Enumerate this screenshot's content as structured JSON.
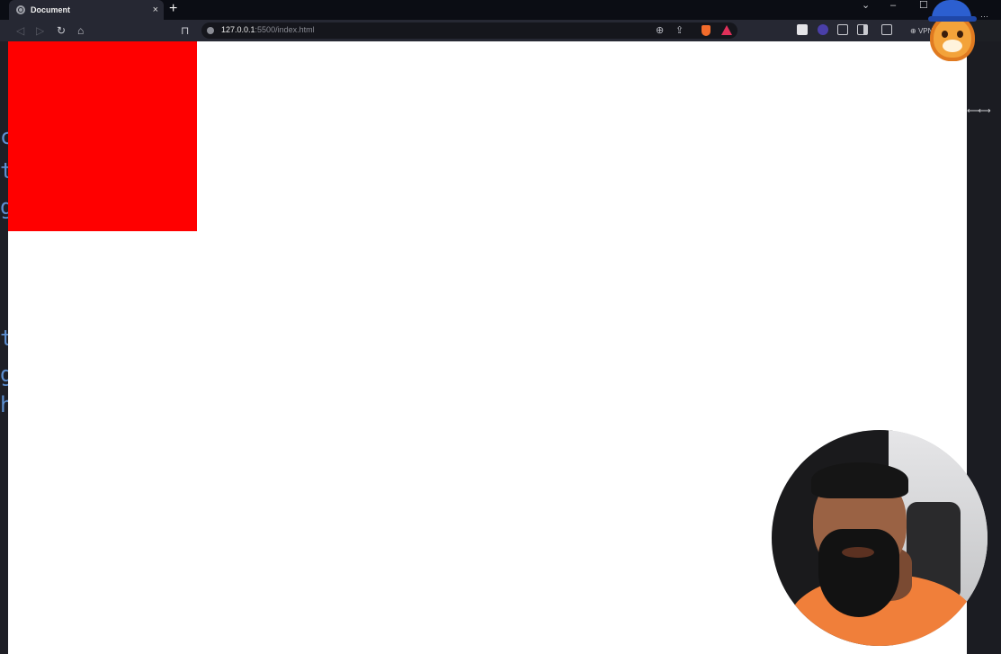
{
  "browser": {
    "tab": {
      "title": "Document",
      "close_glyph": "×"
    },
    "new_tab_glyph": "+",
    "window_controls": {
      "dropdown": "⌄",
      "minimize": "–",
      "maximize": "☐",
      "more": "···"
    },
    "nav": {
      "back": "◁",
      "forward": "▷",
      "reload": "↻",
      "home": "⌂",
      "bookmark": "⊓"
    },
    "url": {
      "host": "127.0.0.1",
      "path": ":5500/index.html"
    },
    "url_icons": {
      "zoom": "⊕",
      "share": "⇪"
    },
    "vpn_label": "VPN"
  },
  "page": {
    "box_color": "#ff0000",
    "background": "#ffffff"
  },
  "editor_edge": {
    "chars": [
      "c",
      "t",
      "g",
      "t",
      "g",
      "h"
    ]
  },
  "gutter": {
    "resize_glyph": "↔"
  },
  "icons": {
    "tab": "globe-icon",
    "brave": "brave-shield-icon",
    "rewards": "brave-rewards-icon",
    "mascot": "lion-wizard-icon",
    "webcam": "presenter-webcam"
  }
}
